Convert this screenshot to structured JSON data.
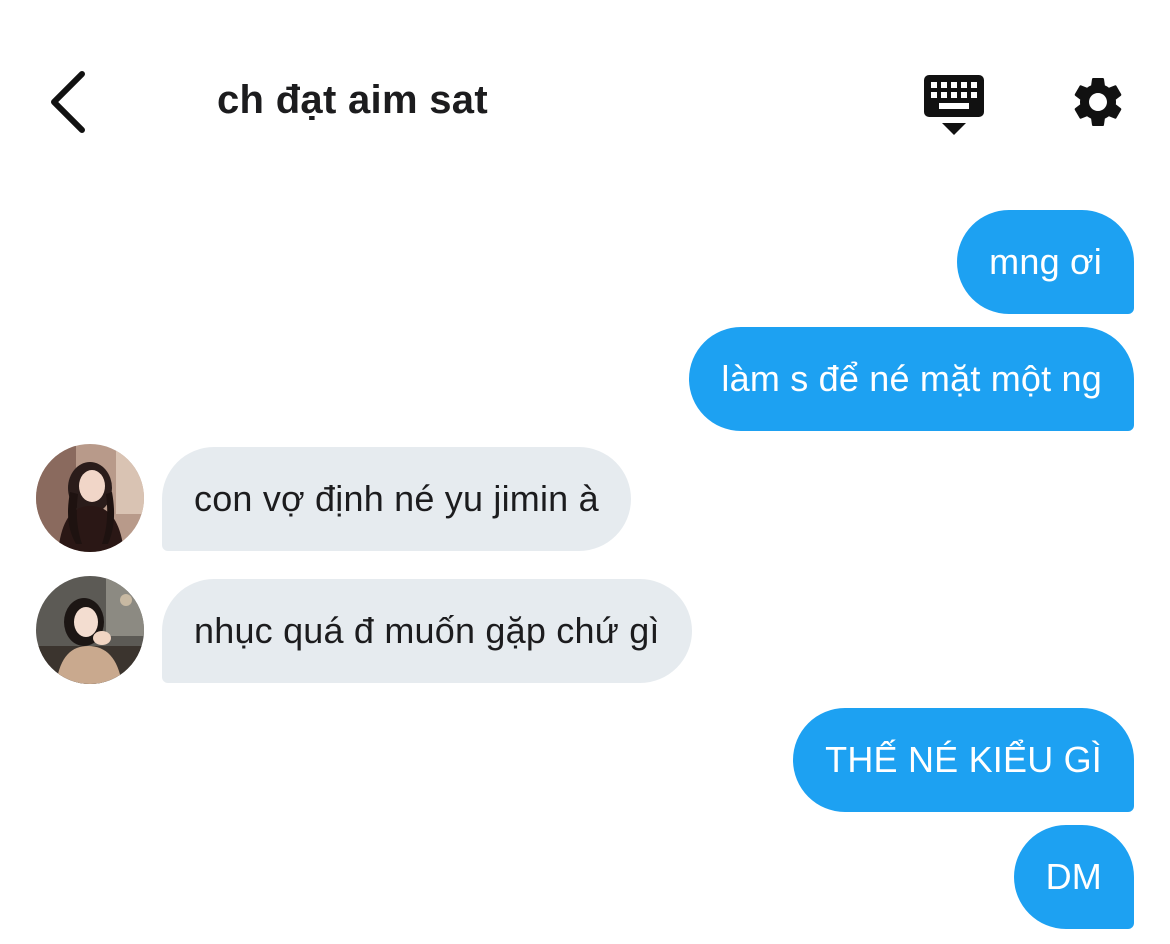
{
  "header": {
    "title": "ch đạt aim sat"
  },
  "icons": {
    "back": "chevron-left-icon",
    "keyboard": "keyboard-icon",
    "settings": "gear-icon"
  },
  "colors": {
    "outgoing_bubble": "#1da1f2",
    "incoming_bubble": "#e6ebef",
    "text_dark": "#1c1c1e"
  },
  "messages": [
    {
      "direction": "outgoing",
      "text": "mng ơi"
    },
    {
      "direction": "outgoing",
      "text": "làm s để né mặt một ng"
    },
    {
      "direction": "incoming",
      "text": "con vợ định né yu jimin à"
    },
    {
      "direction": "incoming",
      "text": "nhục quá đ muốn gặp chứ gì"
    },
    {
      "direction": "outgoing",
      "text": "THẾ NÉ KIỂU GÌ"
    },
    {
      "direction": "outgoing",
      "text": "DM"
    }
  ]
}
